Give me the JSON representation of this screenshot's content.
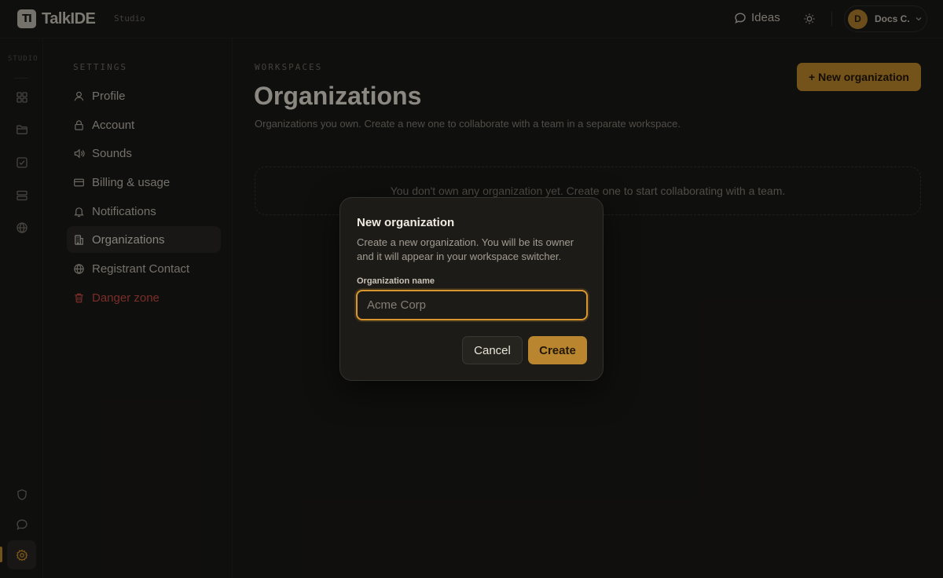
{
  "app": {
    "logo_mark": "TI",
    "name": "TalkIDE",
    "subtitle": "Studio"
  },
  "header": {
    "ideas_label": "Ideas",
    "ideas_icon": "chat-bubble-icon",
    "theme_icon": "sun-icon",
    "user": {
      "initial": "D",
      "name": "Docs C."
    }
  },
  "rail": {
    "label": "STUDIO",
    "items": [
      "grid-icon",
      "folder-icon",
      "checkbox-icon",
      "server-icon",
      "globe-icon"
    ],
    "bottom_items": [
      "shield-icon",
      "chat-icon",
      "gear-icon"
    ]
  },
  "settings_nav": {
    "heading": "SETTINGS",
    "items": [
      {
        "label": "Profile",
        "icon": "user-icon"
      },
      {
        "label": "Account",
        "icon": "lock-icon"
      },
      {
        "label": "Sounds",
        "icon": "speaker-icon"
      },
      {
        "label": "Billing & usage",
        "icon": "credit-card-icon"
      },
      {
        "label": "Notifications",
        "icon": "bell-icon"
      },
      {
        "label": "Organizations",
        "icon": "building-icon",
        "active": true
      },
      {
        "label": "Registrant Contact",
        "icon": "globe-icon"
      },
      {
        "label": "Danger zone",
        "icon": "trash-icon",
        "danger": true
      }
    ]
  },
  "main": {
    "section_label": "WORKSPACES",
    "title": "Organizations",
    "description": "Organizations you own. Create a new one to collaborate with a team in a separate workspace.",
    "new_button": "+ New organization",
    "empty_state": "You don't own any organization yet. Create one to start collaborating with a team."
  },
  "modal": {
    "title": "New organization",
    "description": "Create a new organization. You will be its owner and it will appear in your workspace switcher.",
    "field_label": "Organization name",
    "input_value": "",
    "input_placeholder": "Acme Corp",
    "cancel_label": "Cancel",
    "create_label": "Create"
  },
  "colors": {
    "accent": "#c98f2e",
    "danger": "#d24f48",
    "background": "#1b1a18"
  }
}
